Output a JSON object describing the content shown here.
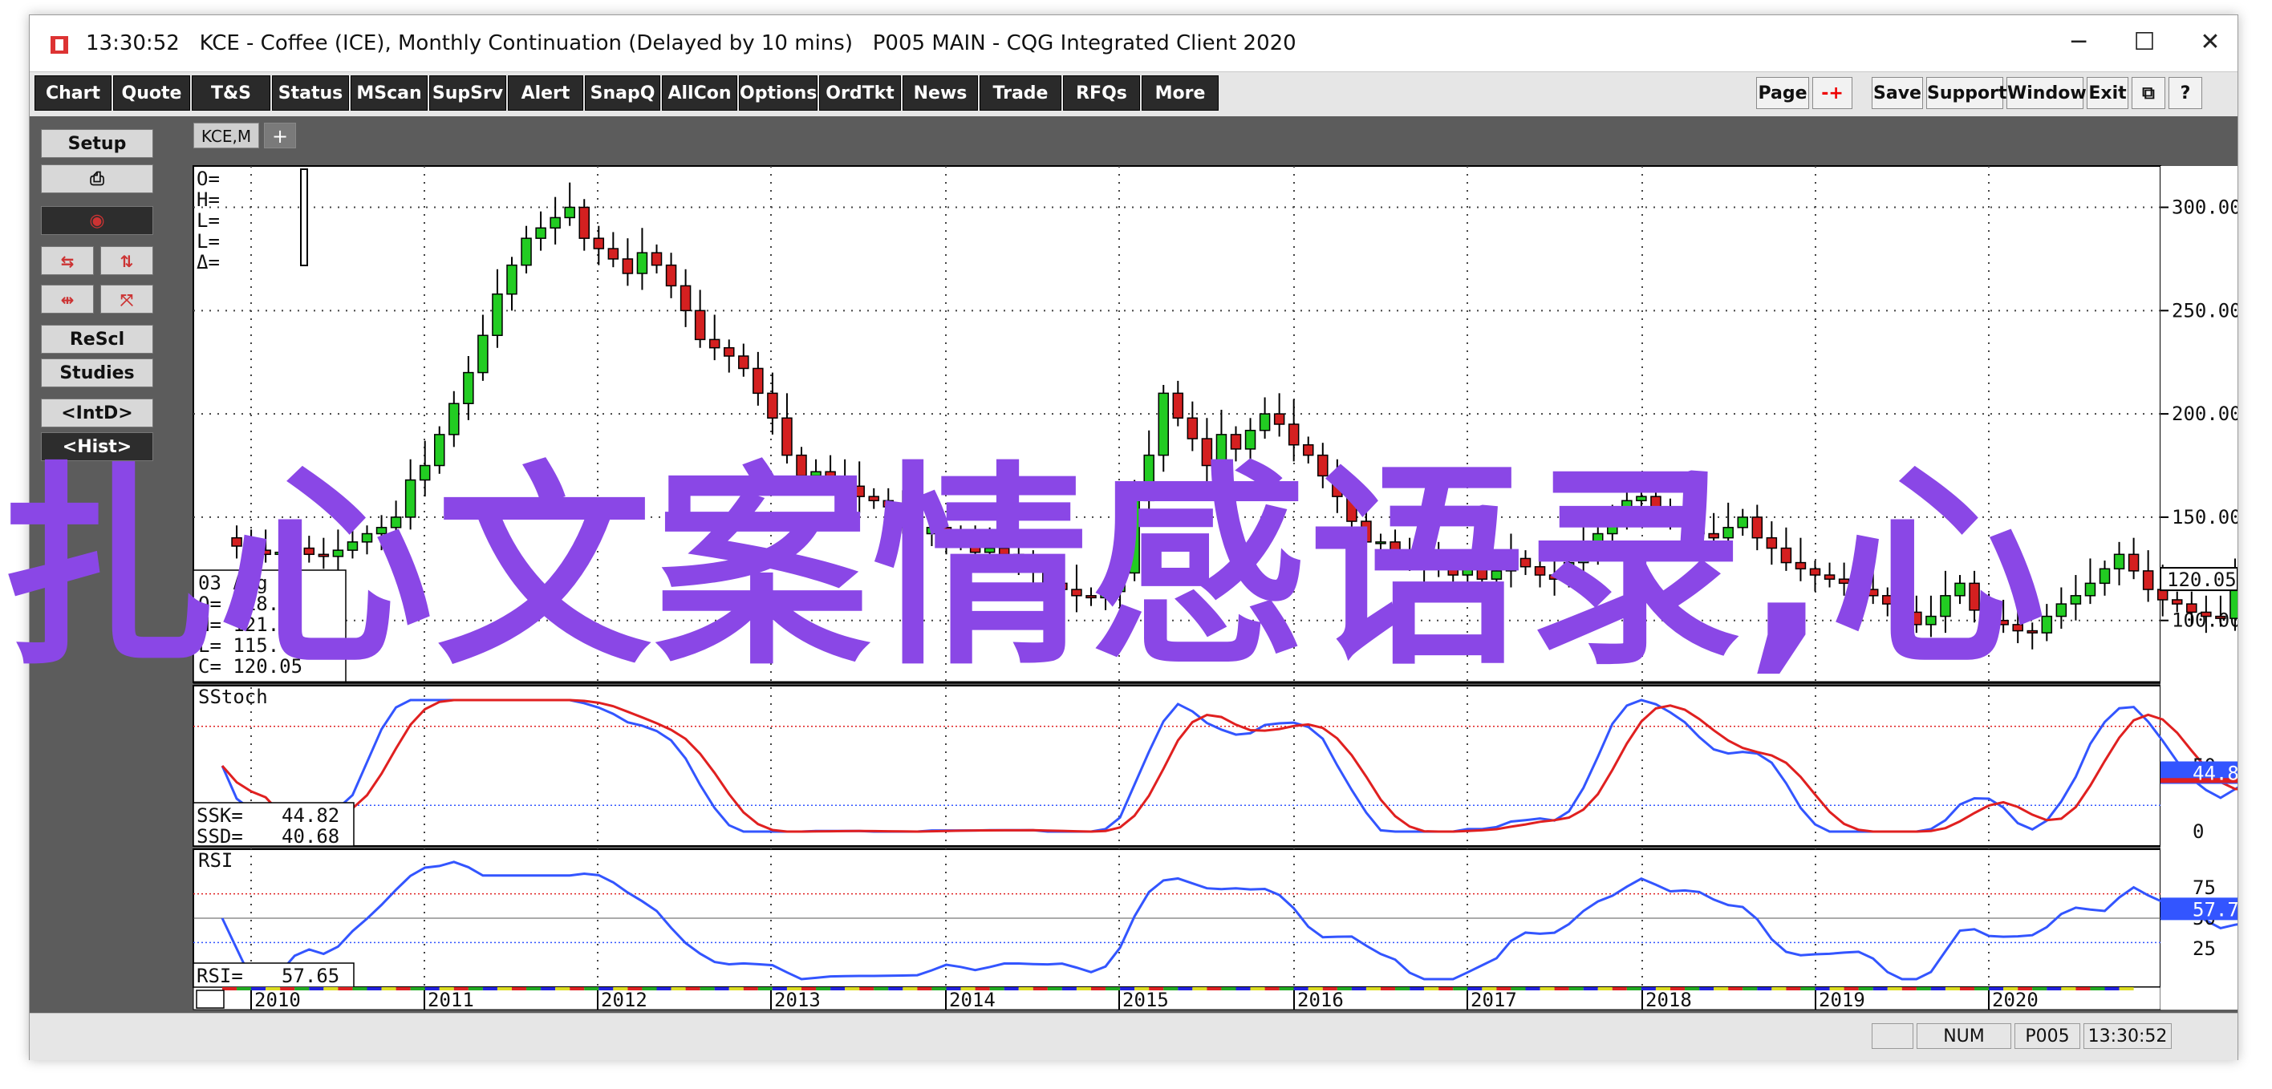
{
  "window": {
    "title": "13:30:52   KCE - Coffee (ICE), Monthly Continuation (Delayed by 10 mins)   P005 MAIN - CQG Integrated Client 2020",
    "controls": {
      "minimize": "─",
      "maximize": "☐",
      "close": "✕"
    }
  },
  "toolbar": {
    "left": [
      "Chart",
      "Quote",
      "T&S",
      "Status",
      "MScan",
      "SupSrv",
      "Alert",
      "SnapQ",
      "AllCon",
      "Options",
      "OrdTkt",
      "News",
      "Trade",
      "RFQs",
      "More"
    ],
    "right": [
      "Page",
      "-+",
      "Save",
      "Support",
      "Window",
      "Exit",
      "⧉",
      "?"
    ]
  },
  "sidebar": {
    "setup": "Setup",
    "print_icon": "printer-icon",
    "record_icon": "record-icon",
    "rescl": "ReScl",
    "studies": "Studies",
    "intd": "<IntD>",
    "hist": "<Hist>"
  },
  "tabs": {
    "symbol": "KCE,M",
    "add": "+"
  },
  "chart_data": {
    "type": "candlestick",
    "ohlc_labels": [
      "O=",
      "H=",
      "L=",
      "L=",
      "Δ="
    ],
    "cursor_box": {
      "date": "03 Aug 2",
      "O": "O=   118.",
      "H": "H=   121.",
      "L": "L=   115.",
      "C": "C=   120.05"
    },
    "price_axis": [
      "300.00",
      "250.00",
      "200.00",
      "150.00",
      "100.00"
    ],
    "price_ylim": [
      70,
      320
    ],
    "last_price": "120.05",
    "x_years": [
      "2010",
      "2011",
      "2012",
      "2013",
      "2014",
      "2015",
      "2016",
      "2017",
      "2018",
      "2019",
      "2020"
    ],
    "close_monthly": [
      140,
      136,
      134,
      132,
      133,
      135,
      132,
      131,
      134,
      138,
      142,
      145,
      150,
      168,
      175,
      190,
      205,
      220,
      238,
      258,
      272,
      285,
      290,
      295,
      300,
      285,
      280,
      275,
      268,
      278,
      272,
      262,
      250,
      236,
      232,
      228,
      222,
      210,
      198,
      180,
      170,
      172,
      168,
      165,
      160,
      158,
      155,
      150,
      142,
      145,
      140,
      138,
      133,
      135,
      132,
      128,
      124,
      118,
      115,
      112,
      111,
      114,
      123,
      158,
      180,
      210,
      198,
      188,
      175,
      190,
      183,
      192,
      200,
      195,
      185,
      180,
      170,
      160,
      148,
      138,
      138,
      132,
      130,
      126,
      125,
      122,
      128,
      120,
      124,
      130,
      126,
      122,
      120,
      128,
      135,
      142,
      150,
      158,
      160,
      155,
      150,
      148,
      142,
      140,
      145,
      150,
      140,
      135,
      128,
      125,
      122,
      120,
      118,
      115,
      112,
      108,
      104,
      98,
      102,
      112,
      118,
      105,
      100,
      98,
      95,
      94,
      102,
      108,
      112,
      118,
      125,
      132,
      124,
      115,
      110,
      108,
      104,
      102,
      101,
      118,
      117,
      120
    ],
    "indicators": {
      "sstoch": {
        "label": "SStoch",
        "ssk": "SSK=",
        "ssk_value": "44.82",
        "ssd": "SSD=",
        "ssd_value": "40.68",
        "axis": [
          "50",
          "0"
        ],
        "last": "44.8",
        "upper": 80,
        "lower": 20
      },
      "rsi": {
        "label": "RSI",
        "rsi": "RSI=",
        "rsi_value": "57.65",
        "axis": [
          "75",
          "50",
          "25"
        ],
        "last": "57.7",
        "upper": 70,
        "lower": 30
      }
    }
  },
  "overlay_text": "扎心文案情感语录,心",
  "statusbar": {
    "num": "NUM",
    "page": "P005",
    "time": "13:30:52"
  },
  "colors": {
    "accent_purple": "#8a47e6",
    "up_candle": "#22cc22",
    "down_candle": "#d42020",
    "stoch_k": "#3355ff",
    "stoch_d": "#e02020"
  }
}
